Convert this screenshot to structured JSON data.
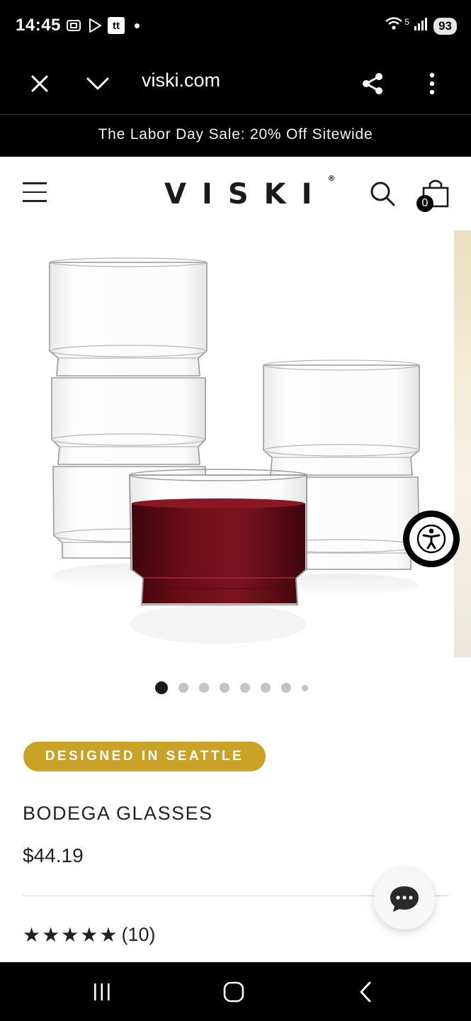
{
  "status_bar": {
    "time": "14:45",
    "network": "5",
    "battery": "93",
    "left_icons": [
      "screenshot-icon",
      "play-store-icon",
      "tt-app-icon"
    ],
    "tt_label": "tt"
  },
  "browser": {
    "url": "viski.com",
    "close_icon": "close-icon",
    "collapse_icon": "chevron-down-icon",
    "share_icon": "share-icon",
    "menu_icon": "more-vertical-icon"
  },
  "promo_banner": {
    "text": "The Labor Day Sale: 20% Off Sitewide"
  },
  "header": {
    "logo": "VISKI",
    "logo_mark": "®",
    "cart_count": "0"
  },
  "gallery": {
    "slide_count": 8,
    "active_index": 0
  },
  "product": {
    "badge": "DESIGNED IN SEATTLE",
    "title": "BODEGA GLASSES",
    "price": "$44.19",
    "rating_stars": "★★★★★",
    "rating_value": 5,
    "review_count": "(10)"
  },
  "colors": {
    "badge_gold": "#c9a227",
    "wine_red": "#5e0a12",
    "text_dark": "#222222"
  }
}
